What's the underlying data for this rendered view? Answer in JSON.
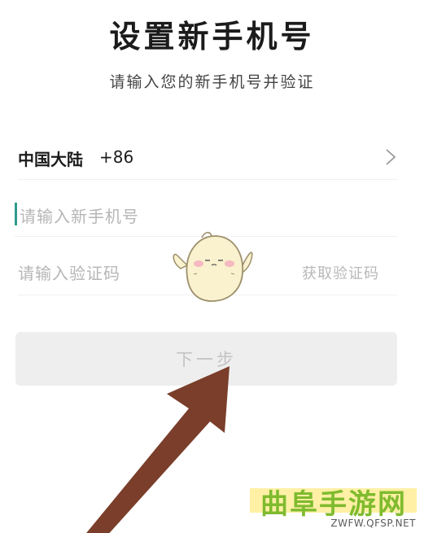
{
  "header": {
    "title": "设置新手机号",
    "subtitle": "请输入您的新手机号并验证"
  },
  "form": {
    "region": "中国大陆",
    "country_code": "+86",
    "phone_placeholder": "请输入新手机号",
    "code_placeholder": "请输入验证码",
    "get_code_label": "获取验证码",
    "next_label": "下一步"
  },
  "icons": {
    "region_chevron": "chevron-right-icon",
    "mascot": "mascot-sticker",
    "pointer": "pointer-arrow"
  },
  "watermark": {
    "text": "曲阜手游网",
    "url": "ZWFW.QFSP.NET"
  },
  "colors": {
    "caret": "#2e9a8a",
    "button_bg": "#eeeeee",
    "button_text": "#c3c3c3",
    "arrow": "#7a3e2a",
    "watermark_text": "#7fbb2e",
    "watermark_bg": "#fff0a5"
  }
}
